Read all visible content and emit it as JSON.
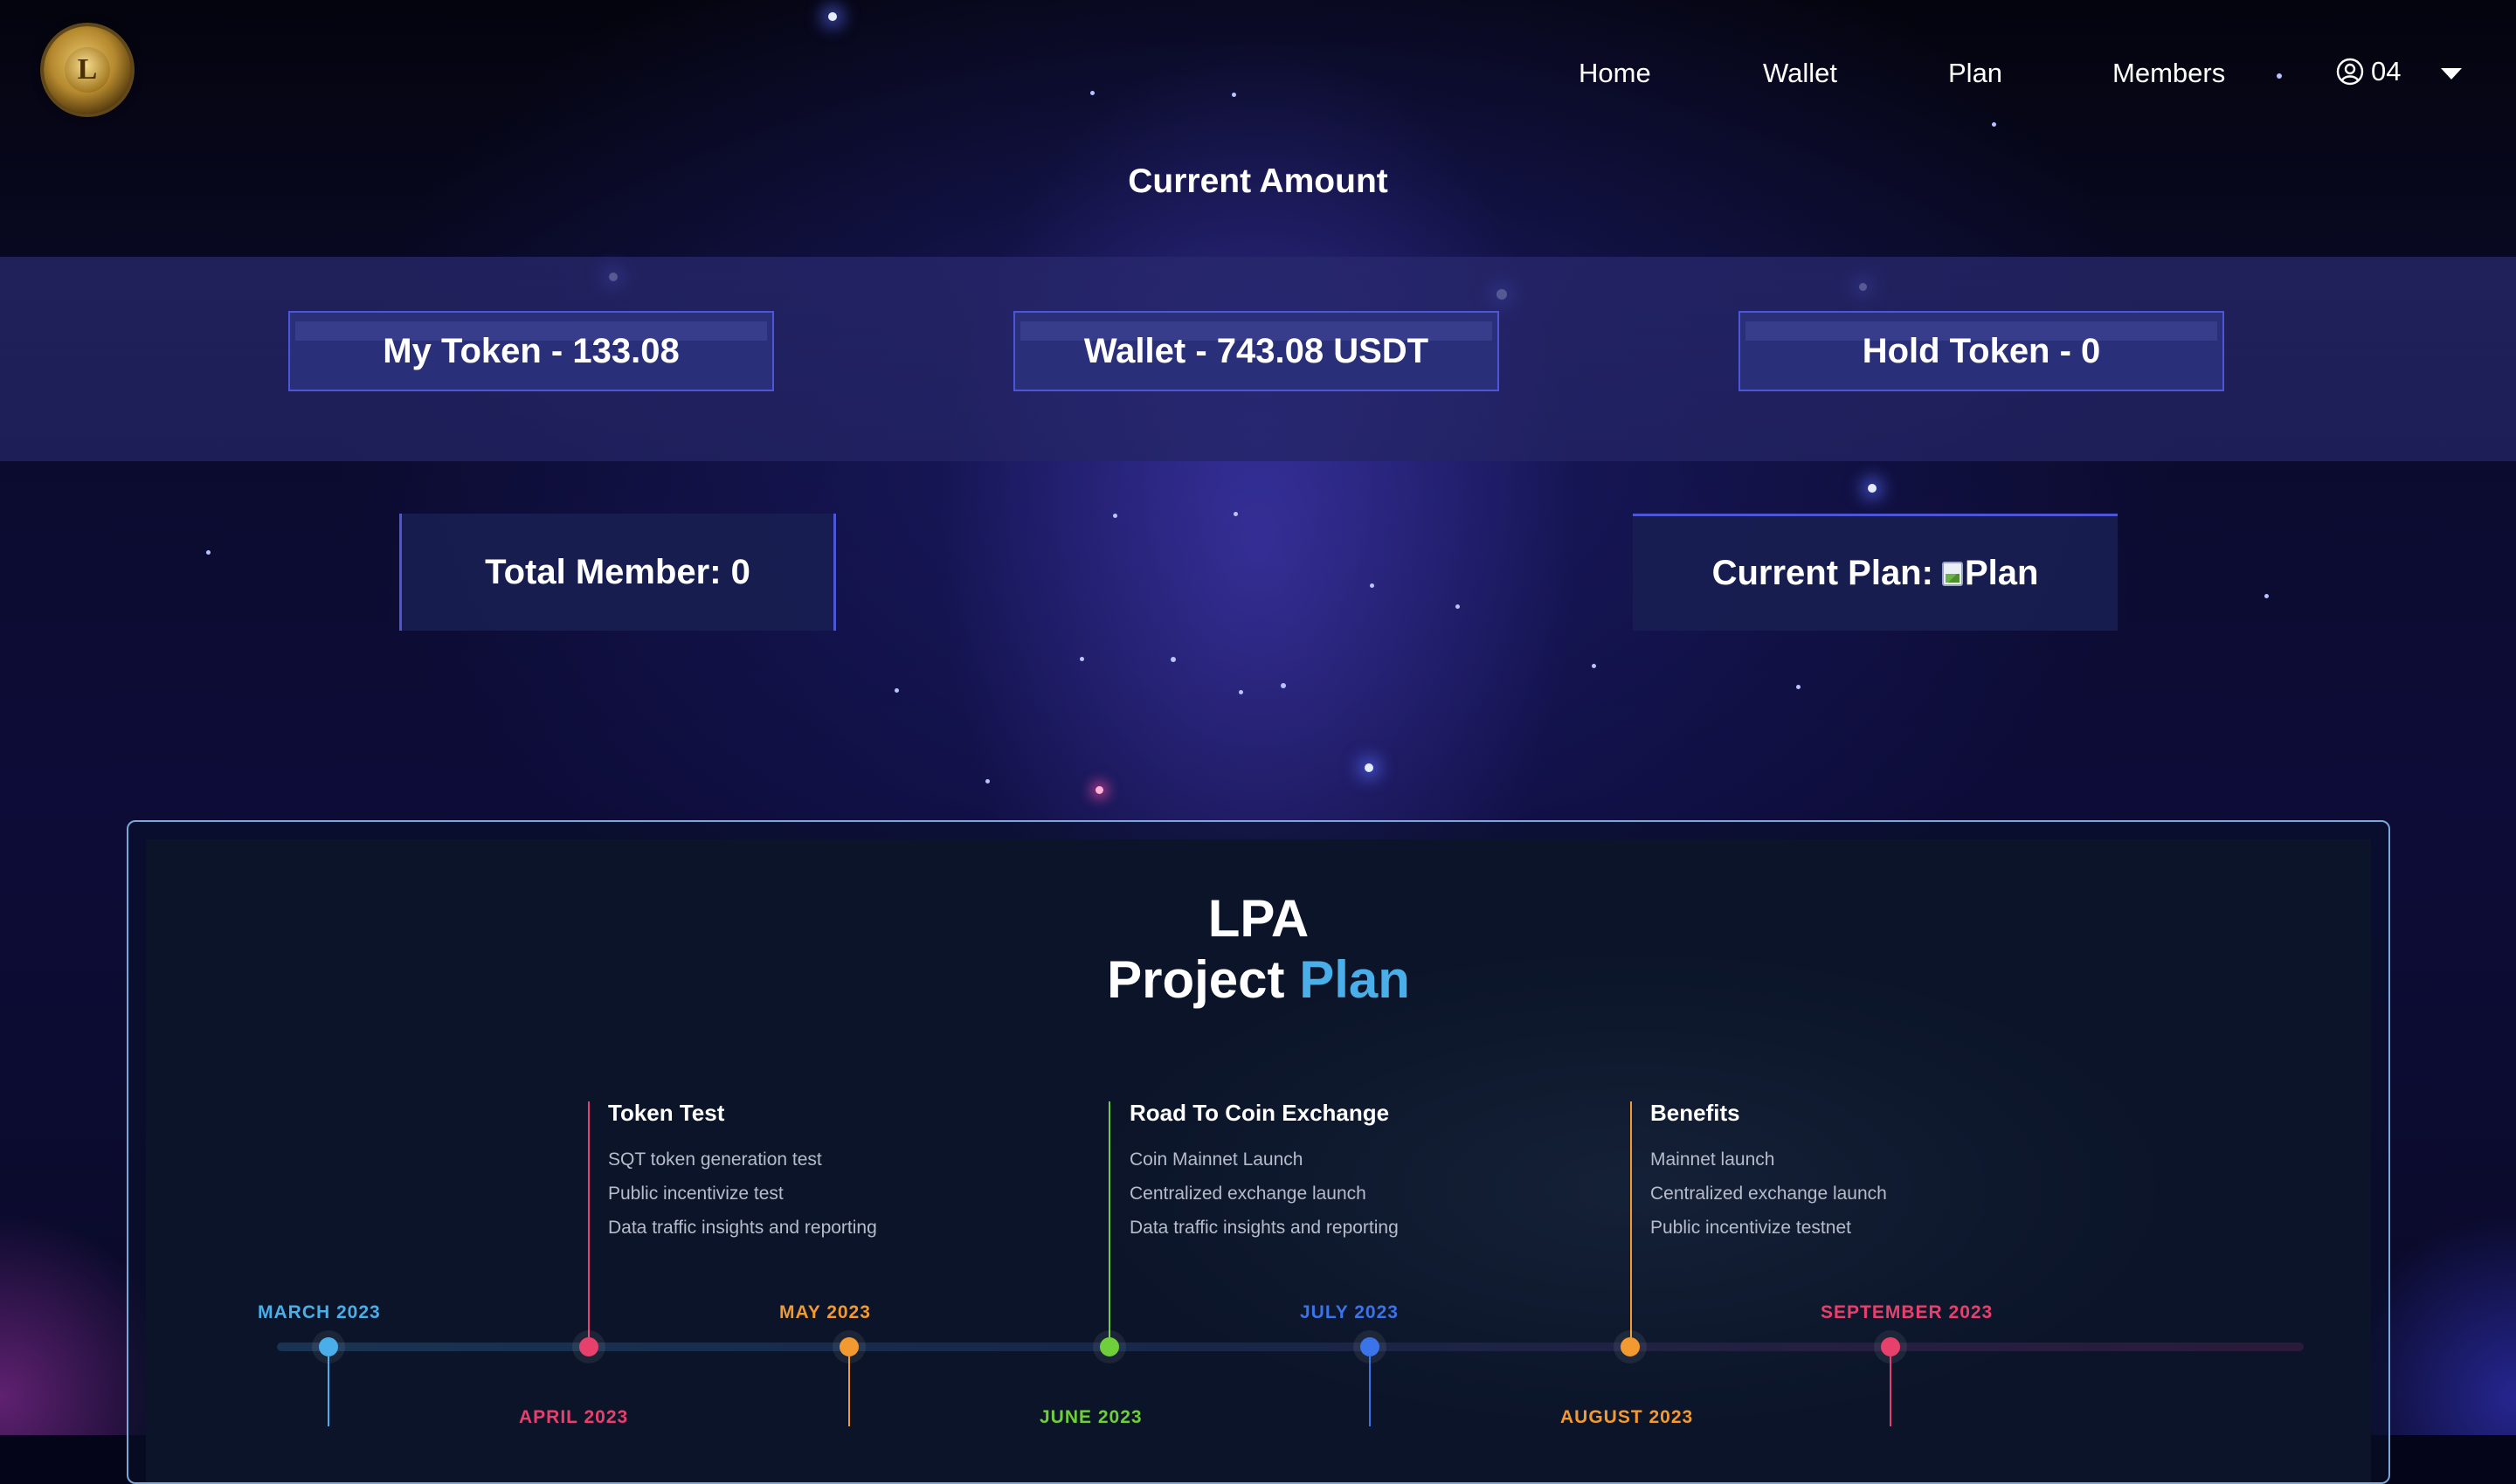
{
  "nav": {
    "links": [
      "Home",
      "Wallet",
      "Plan",
      "Members"
    ],
    "user_label": "04"
  },
  "heading": "Current Amount",
  "balances": {
    "my_token": "My Token - 133.08",
    "wallet": "Wallet - 743.08 USDT",
    "hold_token": "Hold Token - 0"
  },
  "stats": {
    "total_member": "Total Member: 0",
    "current_plan_label": "Current Plan:",
    "current_plan_img_alt": "Plan"
  },
  "plan": {
    "title_line1": "LPA",
    "title_word1": "Project",
    "title_word2": "Plan",
    "months": [
      {
        "label": "MARCH 2023",
        "color": "#4aaee8"
      },
      {
        "label": "APRIL 2023",
        "color": "#e8406d"
      },
      {
        "label": "MAY 2023",
        "color": "#f29a30"
      },
      {
        "label": "JUNE 2023",
        "color": "#6fcf3a"
      },
      {
        "label": "JULY 2023",
        "color": "#3b73e8"
      },
      {
        "label": "AUGUST 2023",
        "color": "#f29a30"
      },
      {
        "label": "SEPTEMBER 2023",
        "color": "#e8406d"
      }
    ],
    "phases": [
      {
        "title": "Token Test",
        "items": [
          "SQT token generation test",
          "Public incentivize test",
          "Data traffic insights and reporting"
        ]
      },
      {
        "title": "Road To Coin Exchange",
        "items": [
          "Coin Mainnet Launch",
          "Centralized exchange launch",
          "Data traffic insights and reporting"
        ]
      },
      {
        "title": "Benefits",
        "items": [
          "Mainnet launch",
          "Centralized exchange launch",
          "Public incentivize testnet"
        ]
      }
    ]
  }
}
